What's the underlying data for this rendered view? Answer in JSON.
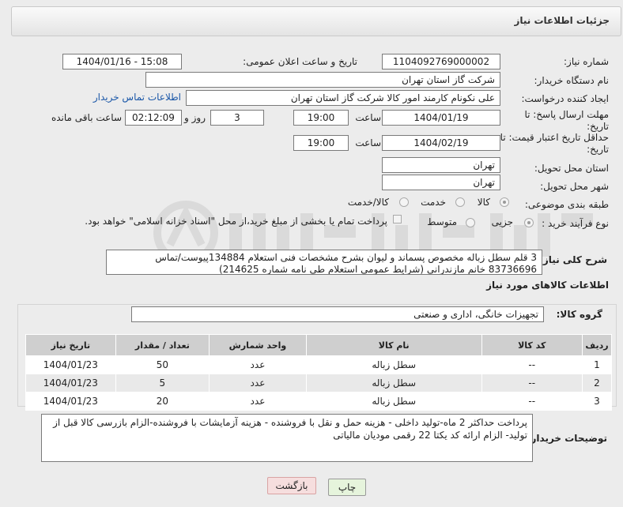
{
  "header": {
    "title": "جزئیات اطلاعات نیاز"
  },
  "form": {
    "need_number_label": "شماره نیاز:",
    "need_number": "1104092769000002",
    "announce_label": "تاریخ و ساعت اعلان عمومی:",
    "announce_value": "1404/01/16 - 15:08",
    "buyer_org_label": "نام دستگاه خریدار:",
    "buyer_org": "شرکت گاز استان تهران",
    "creator_label": "ایجاد کننده درخواست:",
    "creator": "علی نکونام کارمند امور کالا شرکت گاز استان تهران",
    "contact_link": "اطلاعات تماس خریدار",
    "deadline_label": "مهلت ارسال پاسخ: تا تاریخ:",
    "deadline_date": "1404/01/19",
    "time_label": "ساعت",
    "deadline_time": "19:00",
    "days_value": "3",
    "days_label": "روز و",
    "remaining_value": "02:12:09",
    "remaining_label": "ساعت باقی مانده",
    "validity_label": "حداقل تاریخ اعتبار قیمت: تا تاریخ:",
    "validity_date": "1404/02/19",
    "validity_time": "19:00",
    "province_label": "استان محل تحویل:",
    "province": "تهران",
    "city_label": "شهر محل تحویل:",
    "city": "تهران",
    "category_label": "طبقه بندی موضوعی:",
    "category_options": [
      "کالا",
      "خدمت",
      "کالا/خدمت"
    ],
    "process_label": "نوع فرآیند خرید :",
    "process_options": [
      "جزیی",
      "متوسط"
    ],
    "payment_note": "پرداخت تمام یا بخشی از مبلغ خرید،از محل \"اسناد خزانه اسلامی\" خواهد بود.",
    "description_label": "شرح کلی نیاز:",
    "description": "3 قلم سطل زباله مخصوص پسماند و لیوان بشرح مشخصات فنی استعلام 134884پیوست/تماس 83736696 خانم مازندرانی (شرایط عمومی استعلام طی نامه شماره 214625)"
  },
  "goods": {
    "section_title": "اطلاعات کالاهای مورد نیاز",
    "group_label": "گروه کالا:",
    "group_value": "تجهیزات خانگی، اداری و صنعتی",
    "columns": [
      "ردیف",
      "کد کالا",
      "نام کالا",
      "واحد شمارش",
      "تعداد / مقدار",
      "تاریخ نیاز"
    ],
    "rows": [
      [
        "1",
        "--",
        "سطل زباله",
        "عدد",
        "50",
        "1404/01/23"
      ],
      [
        "2",
        "--",
        "سطل زباله",
        "عدد",
        "5",
        "1404/01/23"
      ],
      [
        "3",
        "--",
        "سطل زباله",
        "عدد",
        "20",
        "1404/01/23"
      ]
    ]
  },
  "notes": {
    "label": "توضیحات خریدار:",
    "text": "پرداخت حداکثر 2 ماه-تولید داخلی - هزینه حمل و نقل با فروشنده - هزینه آزمایشات با فروشنده-الزام بازرسی کالا قبل از تولید- الزام ارائه کد یکتا 22 رقمی مودیان مالیاتی"
  },
  "buttons": {
    "print": "چاپ",
    "back": "بازگشت"
  },
  "colors": {
    "link": "#1a57a8",
    "print_bg": "#e6f4dc",
    "back_bg": "#f6dede"
  }
}
